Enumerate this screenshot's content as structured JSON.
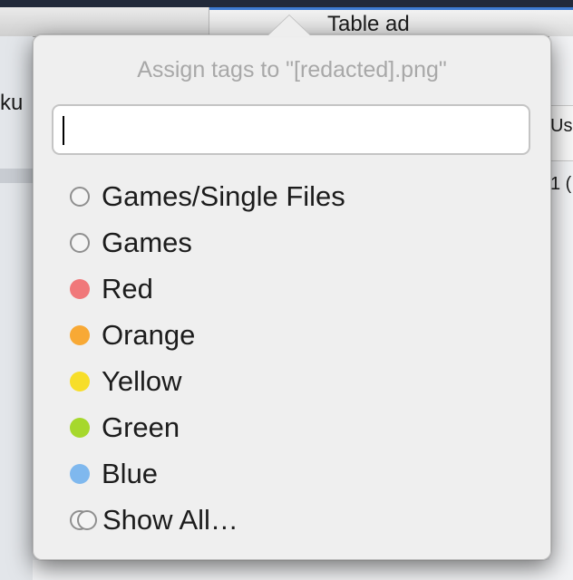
{
  "background": {
    "tab_title": "Table ad",
    "left_text": "ku",
    "right_header_text": "Us",
    "right_cell_text": "1 (",
    "tab_accent_color": "#3e7bd1"
  },
  "popover": {
    "title": "Assign tags to \"[redacted].png\"",
    "input": {
      "value": "",
      "placeholder": ""
    },
    "tags": [
      {
        "label": "Games/Single Files",
        "color": "none",
        "icon": "empty-circle-icon"
      },
      {
        "label": "Games",
        "color": "none",
        "icon": "empty-circle-icon"
      },
      {
        "label": "Red",
        "color": "#f0787a",
        "icon": "red-dot-icon"
      },
      {
        "label": "Orange",
        "color": "#f8a935",
        "icon": "orange-dot-icon"
      },
      {
        "label": "Yellow",
        "color": "#f7de2a",
        "icon": "yellow-dot-icon"
      },
      {
        "label": "Green",
        "color": "#a6d82c",
        "icon": "green-dot-icon"
      },
      {
        "label": "Blue",
        "color": "#7fb8ee",
        "icon": "blue-dot-icon"
      }
    ],
    "show_all_label": "Show All…"
  }
}
